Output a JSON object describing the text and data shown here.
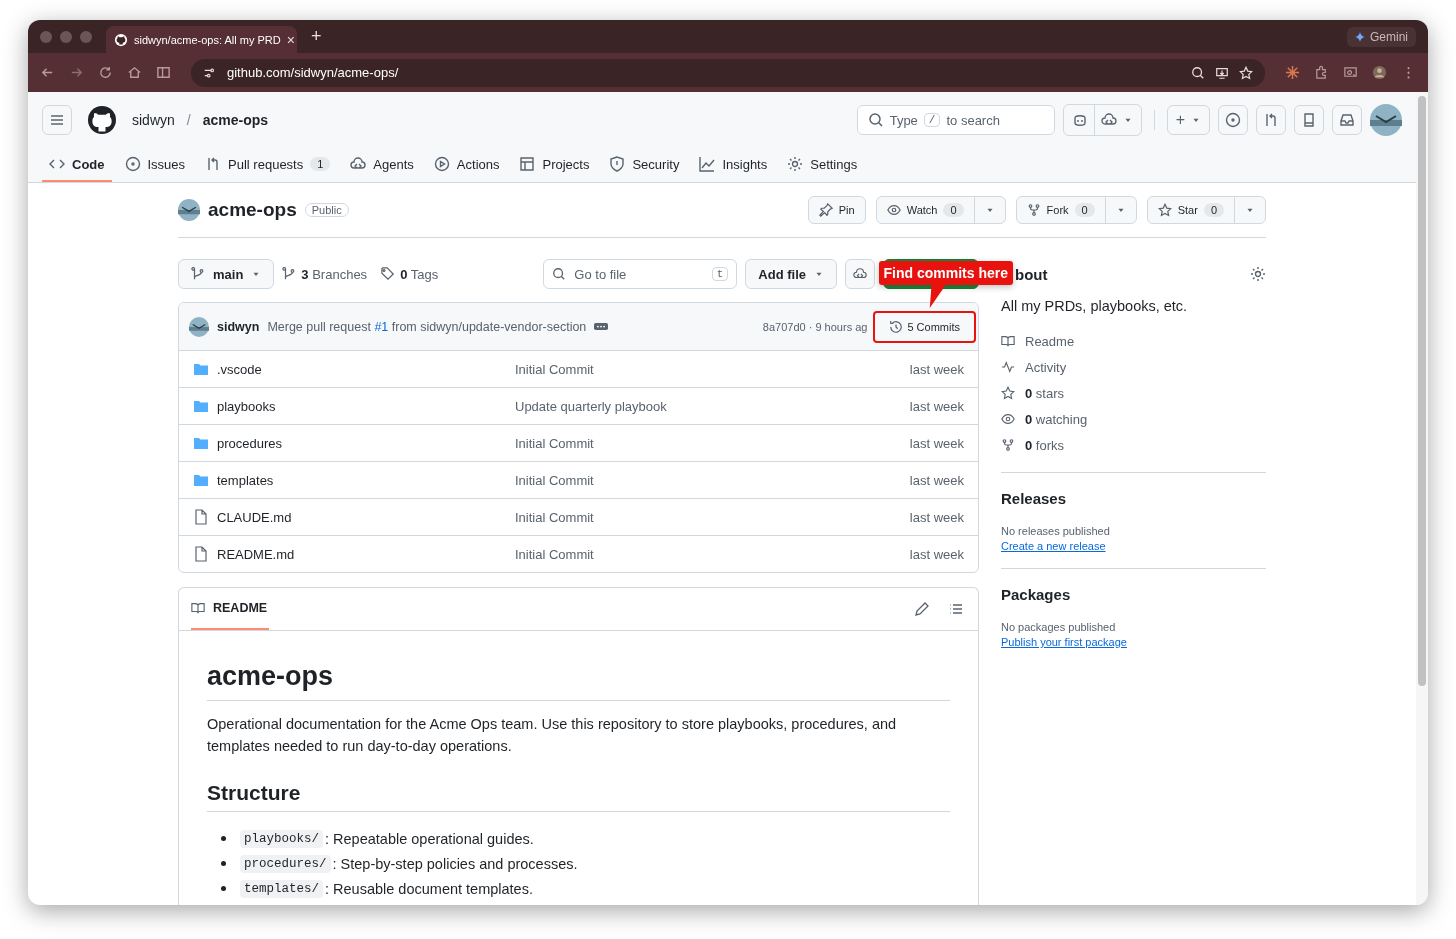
{
  "browser": {
    "tab_title": "sidwyn/acme-ops: All my PRD",
    "tab_close": "×",
    "new_tab": "+",
    "gemini": "Gemini",
    "url": "github.com/sidwyn/acme-ops/"
  },
  "header": {
    "owner": "sidwyn",
    "separator": "/",
    "repo": "acme-ops",
    "search_prefix": "Type",
    "search_key": "/",
    "search_suffix": "to search",
    "new_button": "+"
  },
  "repo_nav": [
    {
      "label": "Code",
      "selected": true
    },
    {
      "label": "Issues",
      "selected": false
    },
    {
      "label": "Pull requests",
      "selected": false,
      "counter": "1"
    },
    {
      "label": "Agents",
      "selected": false
    },
    {
      "label": "Actions",
      "selected": false
    },
    {
      "label": "Projects",
      "selected": false
    },
    {
      "label": "Security",
      "selected": false
    },
    {
      "label": "Insights",
      "selected": false
    },
    {
      "label": "Settings",
      "selected": false
    }
  ],
  "repo": {
    "name": "acme-ops",
    "visibility": "Public",
    "actions": [
      {
        "kind": "pin",
        "label": "Pin"
      },
      {
        "kind": "watch",
        "label": "Watch",
        "count": "0"
      },
      {
        "kind": "fork",
        "label": "Fork",
        "count": "0"
      },
      {
        "kind": "star",
        "label": "Star",
        "count": "0"
      }
    ]
  },
  "toolbar": {
    "branch": "main",
    "branches_count": "3",
    "branches_label": "Branches",
    "tags_count": "0",
    "tags_label": "Tags",
    "go_to_file": "Go to file",
    "go_key": "t",
    "add_file": "Add file"
  },
  "callout": {
    "text": "Find commits here"
  },
  "commit": {
    "author": "sidwyn",
    "message_before": "Merge pull request ",
    "message_link": "#1",
    "message_after": " from sidwyn/update-vendor-section",
    "hash_time": "8a707d0 · 9 hours ag",
    "commits": "5 Commits"
  },
  "files": [
    {
      "kind": "folder",
      "name": ".vscode",
      "message": "Initial Commit",
      "time": "last week"
    },
    {
      "kind": "folder",
      "name": "playbooks",
      "message": "Update quarterly playbook",
      "time": "last week"
    },
    {
      "kind": "folder",
      "name": "procedures",
      "message": "Initial Commit",
      "time": "last week"
    },
    {
      "kind": "folder",
      "name": "templates",
      "message": "Initial Commit",
      "time": "last week"
    },
    {
      "kind": "file",
      "name": "CLAUDE.md",
      "message": "Initial Commit",
      "time": "last week"
    },
    {
      "kind": "file",
      "name": "README.md",
      "message": "Initial Commit",
      "time": "last week"
    }
  ],
  "readme": {
    "tab": "README",
    "title": "acme-ops",
    "paragraph": "Operational documentation for the Acme Ops team. Use this repository to store playbooks, procedures, and templates needed to run day-to-day operations.",
    "subtitle": "Structure",
    "items": [
      {
        "code": "playbooks/",
        "text": ": Repeatable operational guides."
      },
      {
        "code": "procedures/",
        "text": ": Step-by-step policies and processes."
      },
      {
        "code": "templates/",
        "text": ": Reusable document templates."
      }
    ]
  },
  "about": {
    "title": "bout",
    "description": "All my PRDs, playbooks, etc.",
    "links": [
      {
        "kind": "book",
        "text": "Readme"
      },
      {
        "kind": "pulse",
        "text": "Activity"
      },
      {
        "kind": "star",
        "text": "**0** stars"
      },
      {
        "kind": "eye",
        "text": "**0** watching"
      },
      {
        "kind": "fork",
        "text": "**0** forks"
      }
    ]
  },
  "releases": {
    "title": "Releases",
    "note": "No releases published",
    "link": "Create a new release"
  },
  "packages": {
    "title": "Packages",
    "note": "No packages published",
    "link": "Publish your first package"
  }
}
